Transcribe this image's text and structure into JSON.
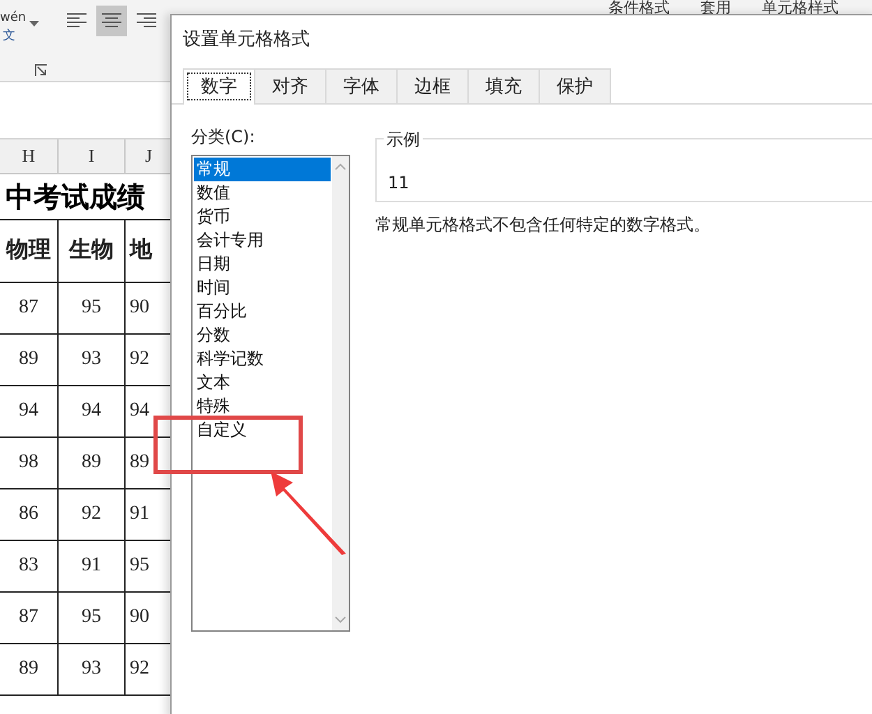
{
  "ribbon": {
    "phonetic": {
      "reading": "wén",
      "char": "文"
    },
    "align_buttons": [
      {
        "kind": "left",
        "selected": false
      },
      {
        "kind": "center",
        "selected": true
      },
      {
        "kind": "right",
        "selected": false
      }
    ],
    "style_buttons": [
      "条件格式",
      "套用",
      "单元格样式"
    ]
  },
  "sheet": {
    "columns": [
      "H",
      "I",
      "J"
    ],
    "title": "中考试成绩",
    "headers": [
      "物理",
      "生物",
      "地"
    ],
    "rows": [
      [
        "87",
        "95",
        "90"
      ],
      [
        "89",
        "93",
        "92"
      ],
      [
        "94",
        "94",
        "94"
      ],
      [
        "98",
        "89",
        "89"
      ],
      [
        "86",
        "92",
        "91"
      ],
      [
        "83",
        "91",
        "95"
      ],
      [
        "87",
        "95",
        "90"
      ],
      [
        "89",
        "93",
        "92"
      ]
    ]
  },
  "dialog": {
    "title": "设置单元格格式",
    "tabs": [
      {
        "label": "数字",
        "selected": true
      },
      {
        "label": "对齐",
        "selected": false
      },
      {
        "label": "字体",
        "selected": false
      },
      {
        "label": "边框",
        "selected": false
      },
      {
        "label": "填充",
        "selected": false
      },
      {
        "label": "保护",
        "selected": false
      }
    ],
    "category_label": "分类(C):",
    "categories": [
      {
        "label": "常规",
        "selected": true
      },
      {
        "label": "数值",
        "selected": false
      },
      {
        "label": "货币",
        "selected": false
      },
      {
        "label": "会计专用",
        "selected": false
      },
      {
        "label": "日期",
        "selected": false
      },
      {
        "label": "时间",
        "selected": false
      },
      {
        "label": "百分比",
        "selected": false
      },
      {
        "label": "分数",
        "selected": false
      },
      {
        "label": "科学记数",
        "selected": false
      },
      {
        "label": "文本",
        "selected": false
      },
      {
        "label": "特殊",
        "selected": false
      },
      {
        "label": "自定义",
        "selected": false
      }
    ],
    "sample": {
      "label": "示例",
      "value": "11"
    },
    "description": "常规单元格格式不包含任何特定的数字格式。"
  }
}
